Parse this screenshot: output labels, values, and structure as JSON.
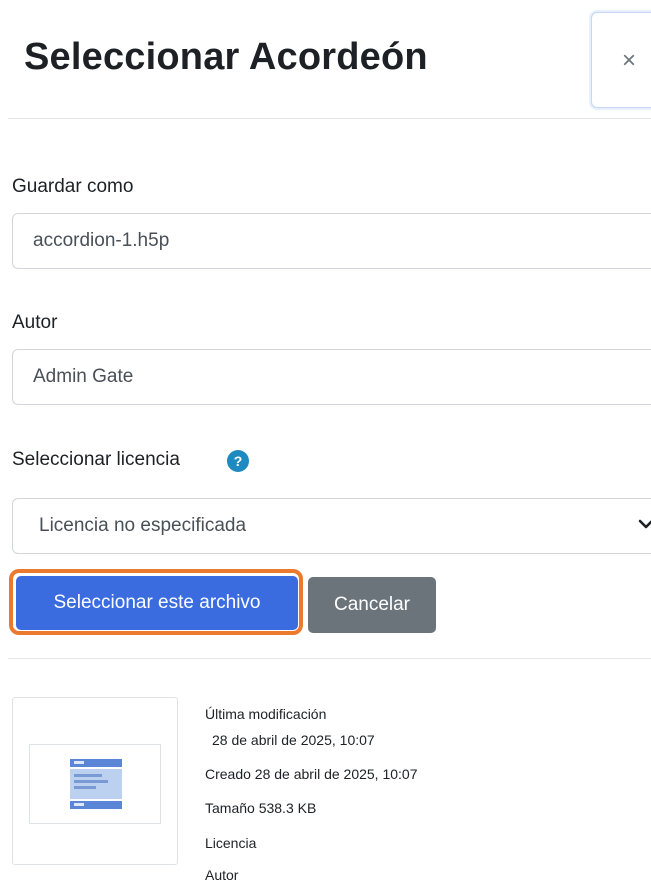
{
  "dialog": {
    "title": "Seleccionar Acordeón",
    "close_label": "×"
  },
  "form": {
    "save_as": {
      "label": "Guardar como",
      "value": "accordion-1.h5p"
    },
    "author": {
      "label": "Autor",
      "value": "Admin Gate"
    },
    "license": {
      "label": "Seleccionar licencia",
      "help_icon": "?",
      "selected": "Licencia no especificada"
    }
  },
  "buttons": {
    "select": "Seleccionar este archivo",
    "cancel": "Cancelar"
  },
  "file_info": {
    "last_modified_label": "Última modificación",
    "last_modified_value": "28 de abril de 2025, 10:07",
    "created": "Creado  28 de abril de 2025, 10:07",
    "size": "Tamaño  538.3 KB",
    "license_label": "Licencia",
    "author_label": "Autor"
  },
  "colors": {
    "primary": "#3a6ce0",
    "focus_outline": "#ec7a2e",
    "secondary": "#6b737b",
    "help_icon": "#1f8ac0"
  }
}
